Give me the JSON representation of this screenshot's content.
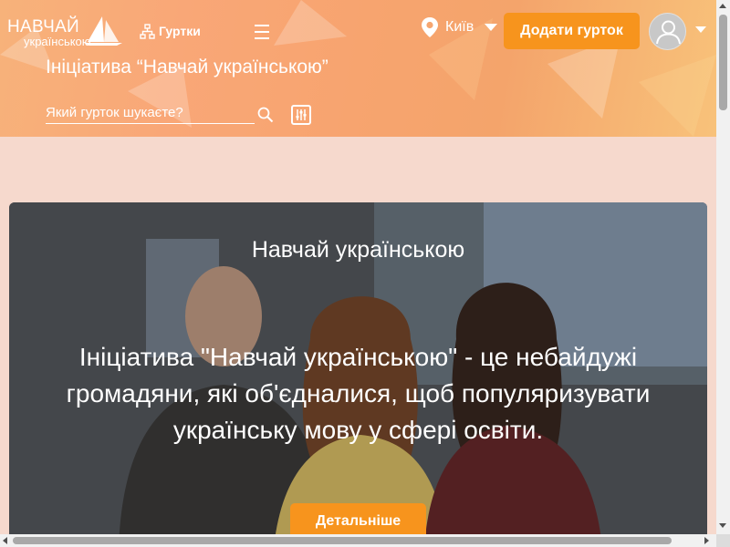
{
  "header": {
    "logo": {
      "line1": "НАВЧАЙ",
      "line2": "українською"
    },
    "nav_clubs_label": "Гуртки",
    "city": "Київ",
    "add_club_label": "Додати гурток",
    "page_title": "Ініціатива “Навчай українською”",
    "search_placeholder": "Який гурток шукаєте?"
  },
  "hero": {
    "title": "Навчай українською",
    "description": "Ініціатива \"Навчай українською\" - це небайдужі громадяни, які об'єдналися, щоб популяризувати українську мову у сфері освіти.",
    "more_label": "Детальніше"
  },
  "colors": {
    "accent": "#f7941d",
    "header_gradient_start": "#f7b27a",
    "page_background": "#f6d9cd"
  },
  "icons": [
    "sailboat-logo-icon",
    "sitemap-icon",
    "menu-icon",
    "location-pin-icon",
    "chevron-down-icon",
    "user-avatar-icon",
    "search-icon",
    "filter-icon"
  ]
}
